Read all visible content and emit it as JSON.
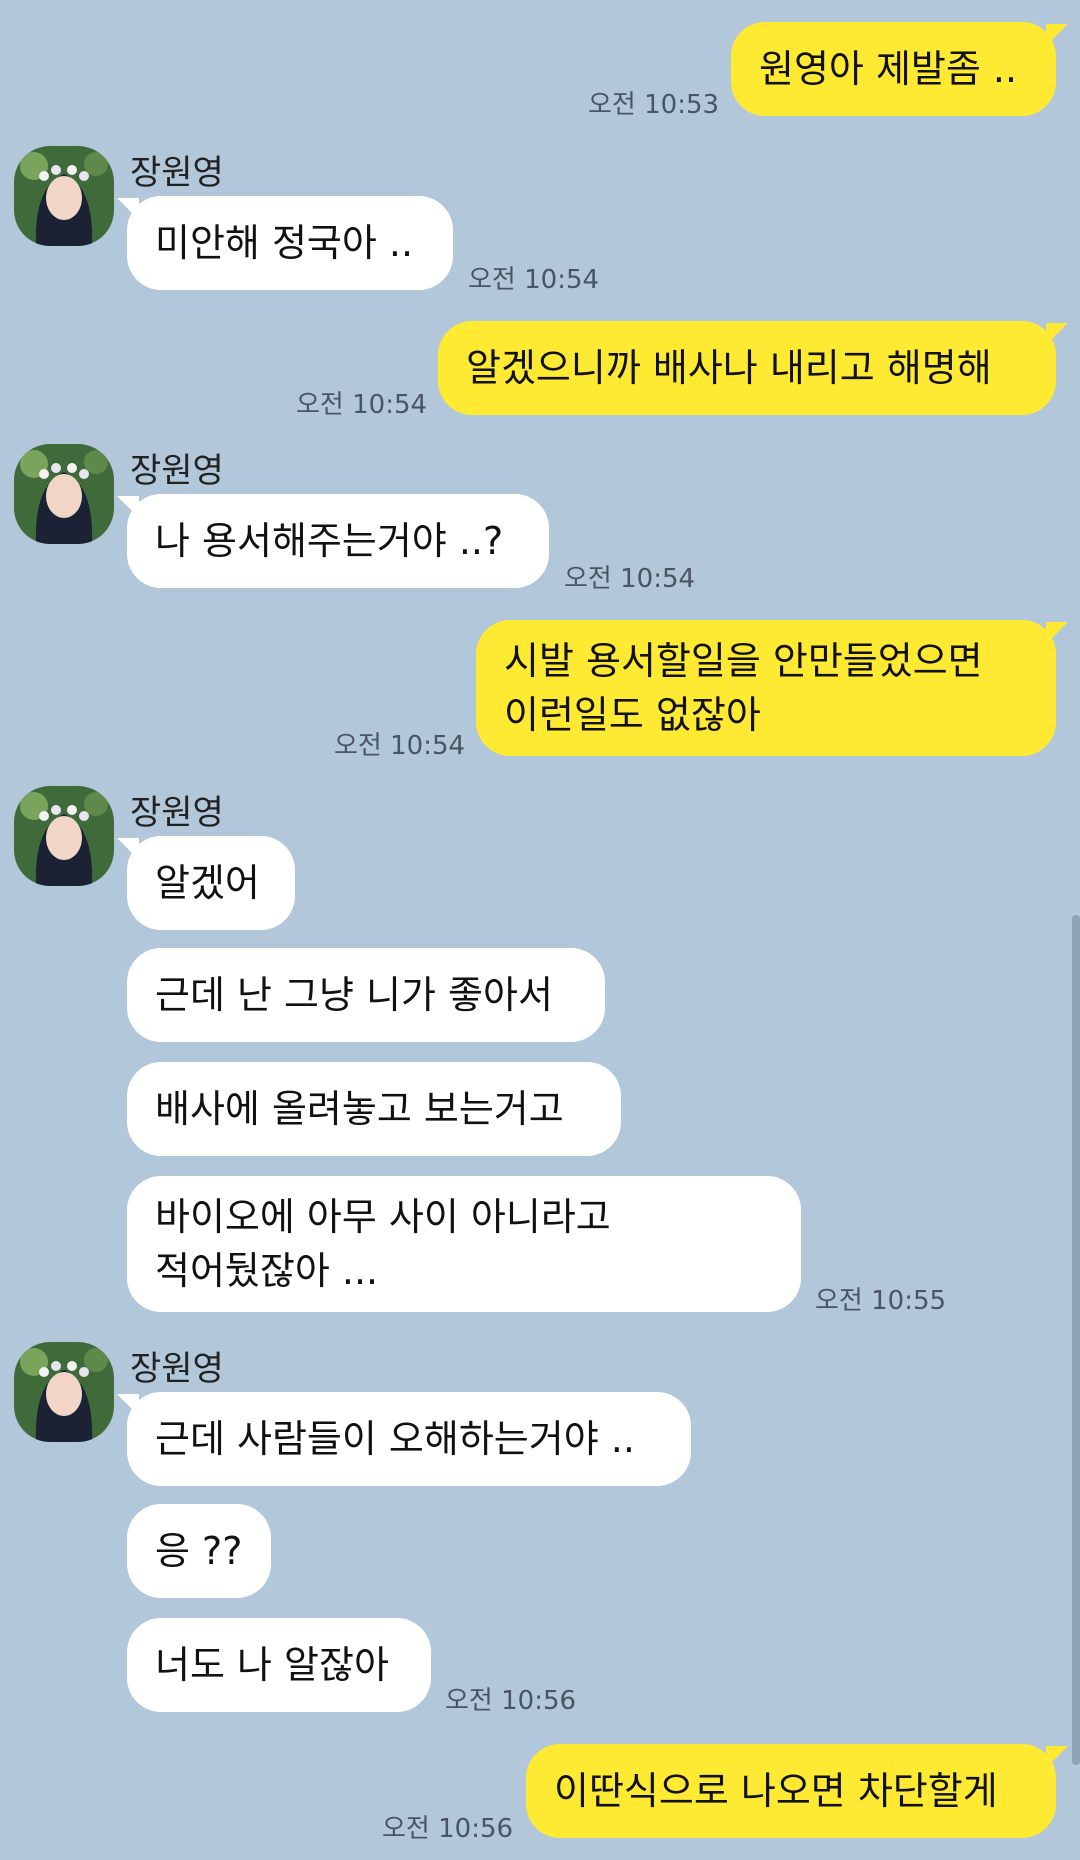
{
  "contact_name": "장원영",
  "messages": [
    {
      "text": "원영아 제발좀 ..",
      "time": "오전 10:53"
    },
    {
      "text": "미안해 정국아 ..",
      "time": "오전 10:54"
    },
    {
      "text": "알겠으니까 배사나 내리고 해명해",
      "time": "오전 10:54"
    },
    {
      "text": "나 용서해주는거야 ..?",
      "time": "오전 10:54"
    },
    {
      "text": "시발 용서할일을 안만들었으면\n이런일도 없잖아",
      "time": "오전 10:54"
    },
    {
      "text": "알겠어"
    },
    {
      "text": "근데 난 그냥 니가 좋아서"
    },
    {
      "text": "배사에 올려놓고 보는거고"
    },
    {
      "text": "바이오에 아무 사이 아니라고\n적어뒀잖아 ...",
      "time": "오전 10:55"
    },
    {
      "text": "근데 사람들이 오해하는거야 .."
    },
    {
      "text": "응 ??"
    },
    {
      "text": "너도 나 알잖아",
      "time": "오전 10:56"
    },
    {
      "text": "이딴식으로 나오면 차단할게",
      "time": "오전 10:56"
    }
  ],
  "colors": {
    "background": "#b2c7da",
    "my_bubble": "#fee933",
    "their_bubble": "#ffffff"
  }
}
